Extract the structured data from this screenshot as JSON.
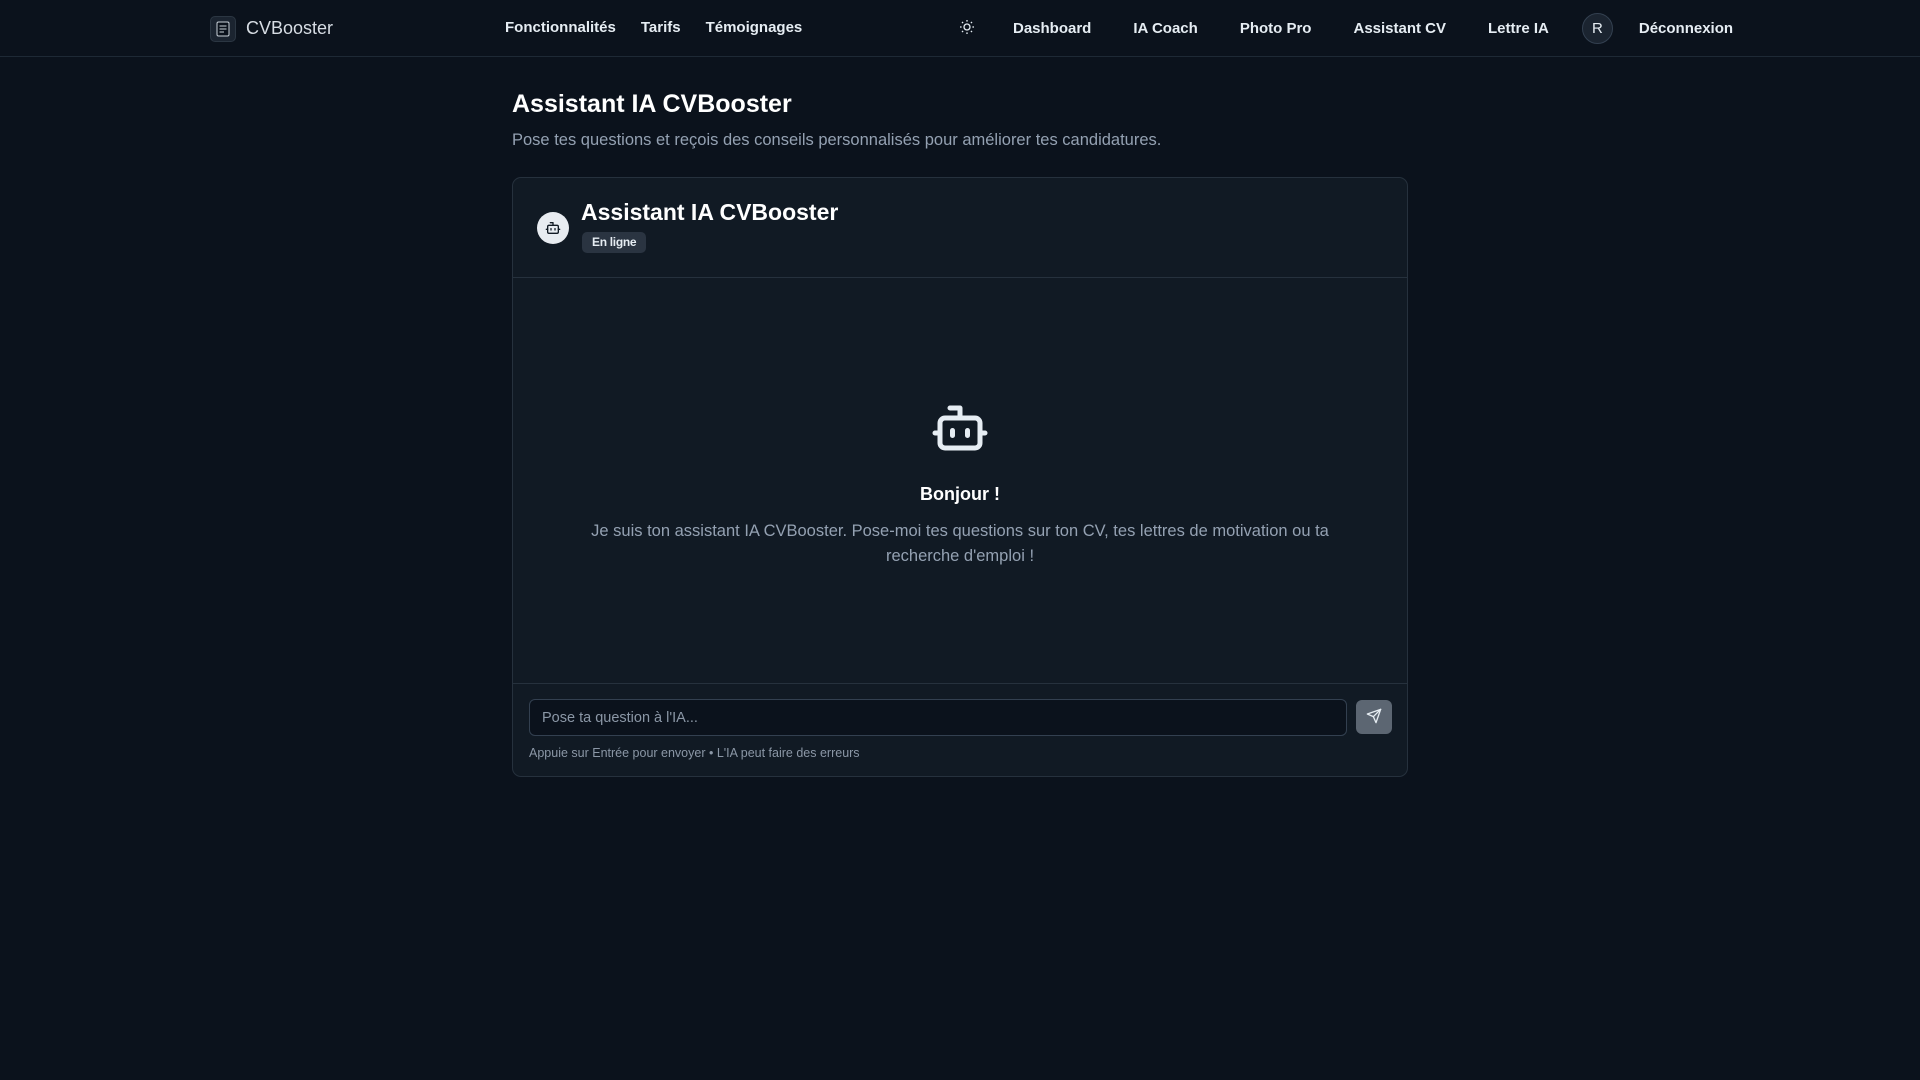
{
  "brand": {
    "name": "CVBooster",
    "icon": "document-icon"
  },
  "nav_left": [
    "Fonctionnalités",
    "Tarifs",
    "Témoignages"
  ],
  "nav_right": {
    "theme_icon": "sun-icon",
    "links": [
      "Dashboard",
      "IA Coach",
      "Photo Pro",
      "Assistant CV",
      "Lettre IA"
    ],
    "avatar_initial": "R",
    "logout": "Déconnexion"
  },
  "page": {
    "title": "Assistant IA CVBooster",
    "subtitle": "Pose tes questions et reçois des conseils personnalisés pour améliorer tes candidatures."
  },
  "chat": {
    "title": "Assistant IA CVBooster",
    "status": "En ligne",
    "bot_icon": "robot-icon",
    "greeting": "Bonjour !",
    "intro": "Je suis ton assistant IA CVBooster. Pose-moi tes questions sur ton CV, tes lettres de motivation ou ta recherche d'emploi !",
    "input_placeholder": "Pose ta question à l'IA...",
    "send_icon": "send-icon",
    "hint": "Appuie sur Entrée pour envoyer • L'IA peut faire des erreurs"
  },
  "colors": {
    "background": "#0b121c",
    "card": "#111a24",
    "border": "#26313d",
    "muted_text": "#94a1b2",
    "send_button": "#5c6672"
  }
}
